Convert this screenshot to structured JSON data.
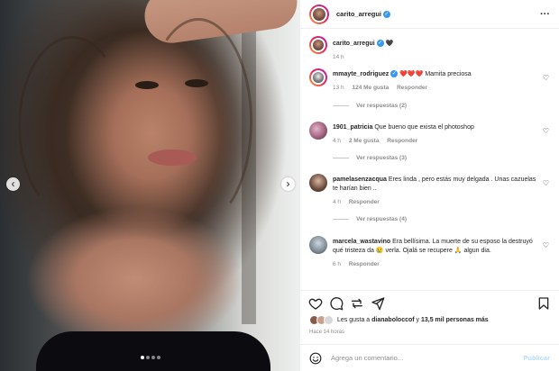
{
  "post": {
    "author": "carito_arregui",
    "more_icon": "ellipsis-icon",
    "caption_author": "carito_arregui",
    "caption_text": "🖤",
    "caption_time": "14 h",
    "carousel": {
      "dots": 4,
      "active": 0,
      "prev_icon": "chevron-left-icon",
      "next_icon": "chevron-right-icon"
    }
  },
  "comments": [
    {
      "user": "mmayte_rodriguez",
      "verified": true,
      "emoji": "❤️❤️❤️",
      "text": "Mamita preciosa",
      "time": "13 h",
      "likes": "124 Me gusta",
      "reply": "Responder",
      "replies": "Ver respuestas (2)"
    },
    {
      "user": "1901_patricia",
      "verified": false,
      "text": "Que bueno que exista el photoshop",
      "time": "4 h",
      "likes": "2 Me gusta",
      "reply": "Responder",
      "replies": "Ver respuestas (3)"
    },
    {
      "user": "pamelasenzacqua",
      "verified": false,
      "text": "Eres linda , pero estás muy delgada . Unas cazuelas te harían bien ..",
      "time": "4 h",
      "reply": "Responder",
      "replies": "Ver respuestas (4)"
    },
    {
      "user": "marcela_wastavino",
      "verified": false,
      "text": "Era bellísima. La muerte de su esposo la destruyó qué tristeza da 😢 verla. Ojalá se recupere 🙏 algun dia.",
      "time": "6 h",
      "reply": "Responder"
    }
  ],
  "actions": {
    "like_icon": "heart-icon",
    "comment_icon": "comment-icon",
    "share_icon": "share-icon",
    "save_icon": "bookmark-icon"
  },
  "likes": {
    "prefix": "Les gusta a ",
    "user": "dianaboloccof",
    "middle": " y ",
    "count": "13,5 mil personas más"
  },
  "timestamp": "Hace 14 horas",
  "composer": {
    "emoji_icon": "smiley-icon",
    "placeholder": "Agrega un comentario...",
    "post_label": "Publicar"
  },
  "colors": {
    "verified": "#3897f0",
    "heart": "#ed4956",
    "post_button": "#b3dbff"
  }
}
